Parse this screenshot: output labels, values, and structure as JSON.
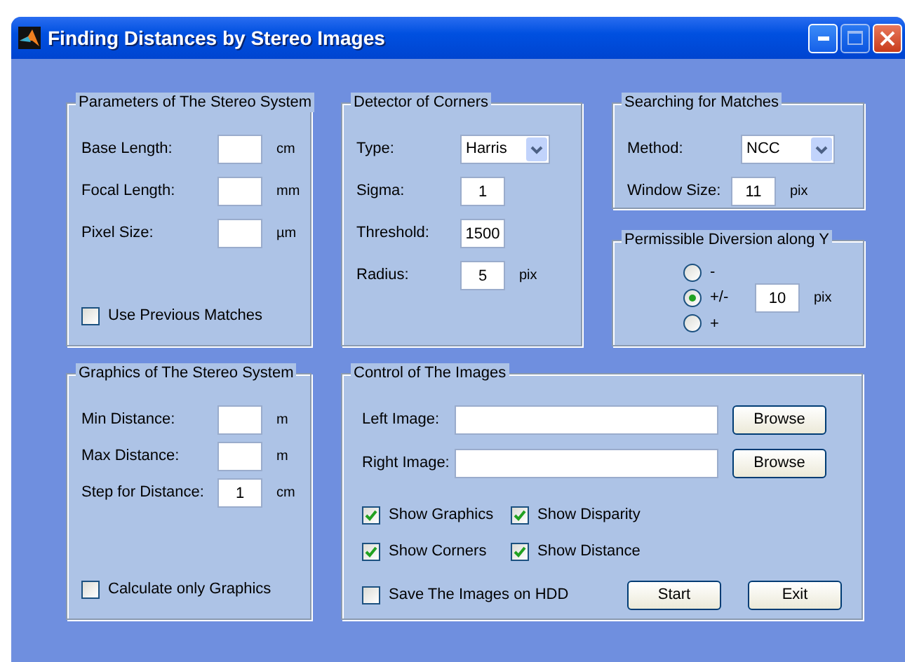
{
  "window": {
    "title": "Finding Distances by Stereo Images"
  },
  "parameters": {
    "title": "Parameters of The Stereo System",
    "fields": [
      {
        "label": "Base Length:",
        "unit": "cm"
      },
      {
        "label": "Focal Length:",
        "unit": "mm"
      },
      {
        "label": "Pixel Size:",
        "unit": "µm"
      }
    ],
    "checkbox": {
      "label": "Use Previous Matches",
      "checked": false
    }
  },
  "detector": {
    "title": "Detector of Corners",
    "rows": [
      {
        "kind": "select",
        "label": "Type:",
        "value": "Harris"
      },
      {
        "kind": "field",
        "label": "Sigma:",
        "value": "1"
      },
      {
        "kind": "field",
        "label": "Threshold:",
        "value": "1500"
      },
      {
        "kind": "field",
        "label": "Radius:",
        "value": "5",
        "unit": "pix"
      }
    ]
  },
  "searching": {
    "title": "Searching for Matches",
    "rows": [
      {
        "kind": "select",
        "label": "Method:",
        "value": "NCC"
      },
      {
        "kind": "field",
        "label": "Window Size:",
        "value": "11",
        "unit": "pix"
      }
    ]
  },
  "diversion": {
    "title": "Permissible Diversion along Y",
    "options": [
      {
        "label": "-",
        "selected": false
      },
      {
        "label": "+/-",
        "selected": true
      },
      {
        "label": "+",
        "selected": false
      }
    ],
    "value": "10",
    "unit": "pix"
  },
  "graphics": {
    "title": "Graphics of The Stereo System",
    "fields": [
      {
        "label": "Min Distance:",
        "unit": "m"
      },
      {
        "label": "Max Distance:",
        "unit": "m"
      },
      {
        "label": "Step for Distance:",
        "value": "1",
        "unit": "cm"
      }
    ],
    "checkbox": {
      "label": "Calculate only Graphics",
      "checked": false
    }
  },
  "control": {
    "title": "Control of The Images",
    "files": [
      {
        "label": "Left Image:",
        "button": "Browse"
      },
      {
        "label": "Right Image:",
        "button": "Browse"
      }
    ],
    "checkboxes": [
      {
        "label": "Show Graphics",
        "checked": true
      },
      {
        "label": "Show Disparity",
        "checked": true
      },
      {
        "label": "Show Corners",
        "checked": true
      },
      {
        "label": "Show Distance",
        "checked": true
      }
    ],
    "save": {
      "label": "Save The Images on HDD",
      "checked": false
    },
    "buttons": [
      "Start",
      "Exit"
    ]
  }
}
